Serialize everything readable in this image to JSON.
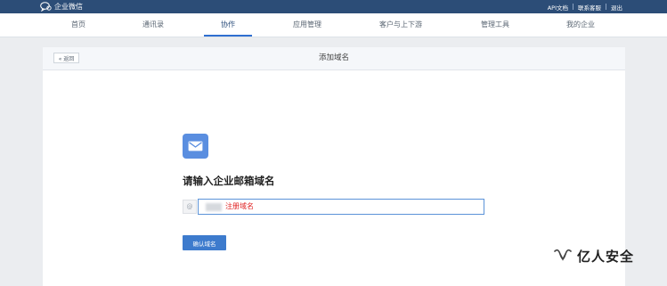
{
  "brand": {
    "name": "企业微信",
    "icon": "chat-bubble-icon"
  },
  "top_links": [
    {
      "label": "API文档"
    },
    {
      "label": "联系客服"
    },
    {
      "label": "退出"
    }
  ],
  "nav": {
    "items": [
      {
        "label": "首页"
      },
      {
        "label": "通讯录"
      },
      {
        "label": "协作",
        "active": true
      },
      {
        "label": "应用管理"
      },
      {
        "label": "客户与上下游"
      },
      {
        "label": "管理工具"
      },
      {
        "label": "我的企业"
      }
    ],
    "active_color": "#2f6fd0"
  },
  "card": {
    "back_label": "« 返回",
    "title": "添加域名",
    "icon": "mail-icon",
    "heading": "请输入企业邮箱域名",
    "at_symbol": "@",
    "input_value": "注册域名",
    "confirm_label": "确认域名"
  },
  "watermark": {
    "text": "亿人安全",
    "icon": "wechat-channel-icon"
  },
  "colors": {
    "topbar": "#2c4d77",
    "accent": "#3d7bcd",
    "input_border": "#5b93d8",
    "input_text": "#e02424"
  }
}
